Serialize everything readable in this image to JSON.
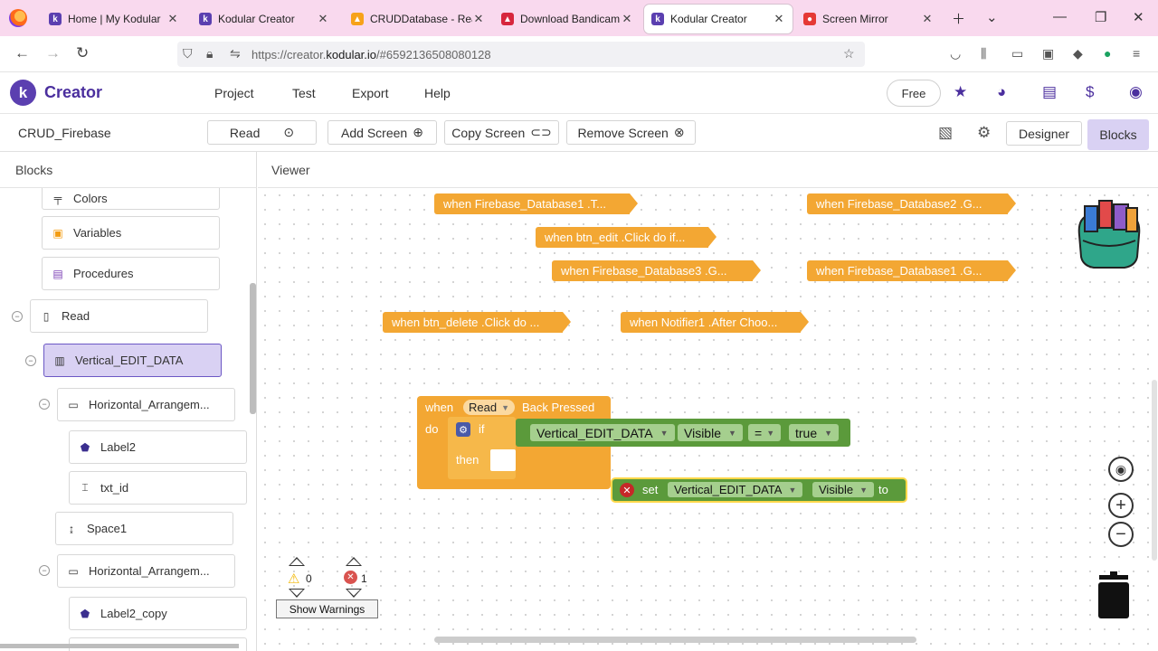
{
  "browser": {
    "tabs": [
      {
        "title": "Home | My Kodular",
        "favicon": "kodular-icon",
        "active": false
      },
      {
        "title": "Kodular Creator",
        "favicon": "kodular-icon",
        "active": false
      },
      {
        "title": "CRUDDatabase - Realti",
        "favicon": "firebase-icon",
        "active": false
      },
      {
        "title": "Download Bandicam F",
        "favicon": "bandicam-icon",
        "active": false
      },
      {
        "title": "Kodular Creator",
        "favicon": "kodular-icon",
        "active": true
      },
      {
        "title": "Screen Mirror",
        "favicon": "screen-mirror-icon",
        "active": false
      }
    ],
    "url_prefix": "https://creator.",
    "url_domain": "kodular.io",
    "url_suffix": "/#6592136508080128"
  },
  "app": {
    "logo_letter": "k",
    "brand": "Creator",
    "menu": [
      "Project",
      "Test",
      "Export",
      "Help"
    ],
    "plan_label": "Free"
  },
  "project": {
    "name": "CRUD_Firebase",
    "screen_select": "Read",
    "add_screen": "Add Screen",
    "copy_screen": "Copy Screen",
    "remove_screen": "Remove Screen",
    "designer": "Designer",
    "blocks": "Blocks"
  },
  "panel": {
    "title": "Blocks",
    "items": [
      {
        "label": "Colors",
        "icon": "paint-roller-icon"
      },
      {
        "label": "Variables",
        "icon": "variables-icon"
      },
      {
        "label": "Procedures",
        "icon": "procedures-icon"
      },
      {
        "label": "Read",
        "icon": "phone-icon"
      },
      {
        "label": "Vertical_EDIT_DATA",
        "icon": "vertical-arrangement-icon"
      },
      {
        "label": "Horizontal_Arrangem...",
        "icon": "horizontal-arrangement-icon"
      },
      {
        "label": "Label2",
        "icon": "label-icon"
      },
      {
        "label": "txt_id",
        "icon": "textbox-icon"
      },
      {
        "label": "Space1",
        "icon": "space-icon"
      },
      {
        "label": "Horizontal_Arrangem...",
        "icon": "horizontal-arrangement-icon"
      },
      {
        "label": "Label2_copy",
        "icon": "label-icon"
      }
    ]
  },
  "viewer": {
    "title": "Viewer",
    "collapsed_blocks": [
      "when  Firebase_Database1 .T...",
      "when  Firebase_Database2 .G...",
      "when  btn_edit .Click do if...",
      "when  Firebase_Database3 .G...",
      "when  Firebase_Database1 .G...",
      "when  btn_delete .Click do ...",
      "when  Notifier1 .After Choo..."
    ],
    "event_block": {
      "when": "when",
      "component": "Read",
      "event": "Back Pressed",
      "do": "do",
      "if": "if",
      "then": "then",
      "compare_component": "Vertical_EDIT_DATA",
      "compare_property": "Visible",
      "operator": "=",
      "value": "true",
      "set": "set",
      "set_component": "Vertical_EDIT_DATA",
      "set_property": "Visible",
      "to": "to"
    },
    "warnings_count": "0",
    "errors_count": "1",
    "show_warnings": "Show Warnings"
  }
}
